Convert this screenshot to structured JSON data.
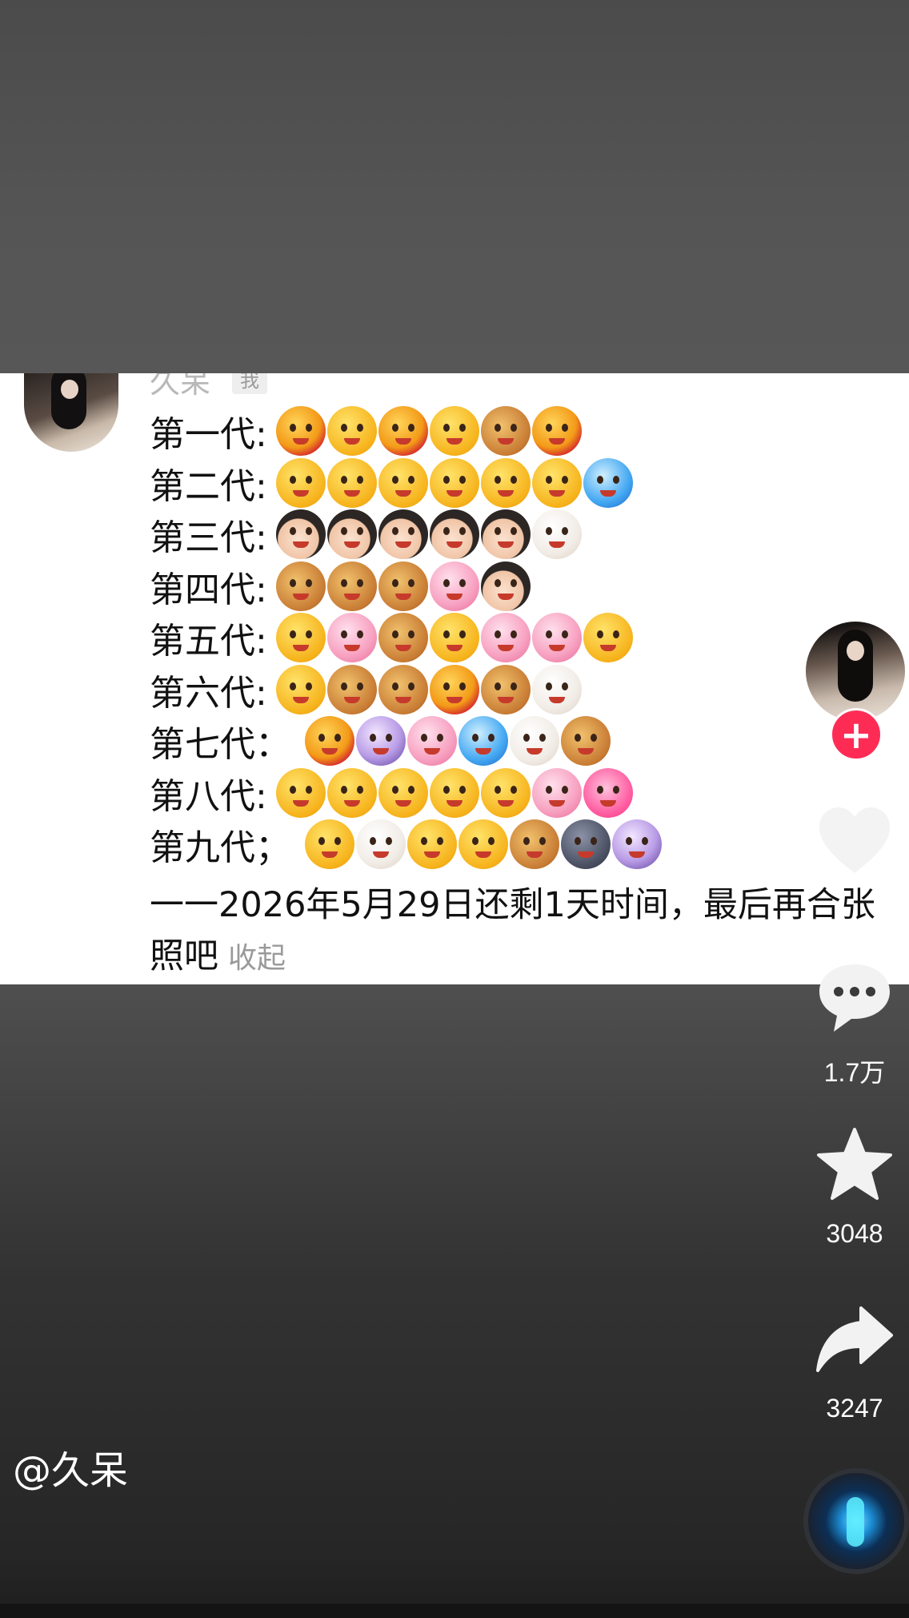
{
  "post": {
    "username": "久呆",
    "name_tag": "我",
    "rows": [
      {
        "label": "第一代:",
        "emojis": [
          "c-red",
          "c-gold",
          "c-red",
          "c-gold",
          "c-brown",
          "c-red"
        ]
      },
      {
        "label": "第二代:",
        "emojis": [
          "c-gold",
          "c-gold",
          "c-gold",
          "c-gold",
          "c-gold",
          "c-gold",
          "c-blue"
        ]
      },
      {
        "label": "第三代:",
        "emojis": [
          "c-dark",
          "c-dark",
          "c-dark",
          "c-dark",
          "c-dark",
          "c-light"
        ]
      },
      {
        "label": "第四代:",
        "emojis": [
          "c-brown",
          "c-brown",
          "c-brown",
          "c-pink",
          "c-dark"
        ]
      },
      {
        "label": "第五代:",
        "emojis": [
          "c-gold",
          "c-pink",
          "c-brown",
          "c-gold",
          "c-pink",
          "c-pink",
          "c-gold"
        ]
      },
      {
        "label": "第六代:",
        "emojis": [
          "c-gold",
          "c-brown",
          "c-brown",
          "c-red",
          "c-brown",
          "c-light"
        ]
      },
      {
        "label": "第七代：",
        "emojis": [
          "c-red",
          "c-purple",
          "c-pink",
          "c-blue",
          "c-light",
          "c-brown"
        ]
      },
      {
        "label": "第八代:",
        "emojis": [
          "c-gold",
          "c-gold",
          "c-gold",
          "c-gold",
          "c-gold",
          "c-pink",
          "c-heart"
        ]
      },
      {
        "label": "第九代；",
        "emojis": [
          "c-gold",
          "c-light",
          "c-gold",
          "c-gold",
          "c-brown",
          "c-grey",
          "c-purple"
        ]
      }
    ],
    "caption": "一一2026年5月29日还剩1天时间，最后再合张照吧",
    "fold_label": "收起"
  },
  "rail": {
    "follow_symbol": "+",
    "like_count": "",
    "comment_count": "1.7万",
    "favorite_count": "3048",
    "share_count": "3247"
  },
  "author_handle": "@久呆",
  "colors": {
    "follow_button": "#fe2c55",
    "card_background": "#ffffff",
    "page_background": "#3a3a3a"
  },
  "icons": [
    "like-heart-icon",
    "comment-icon",
    "favorite-star-icon",
    "share-arrow-icon",
    "music-disc-icon"
  ]
}
